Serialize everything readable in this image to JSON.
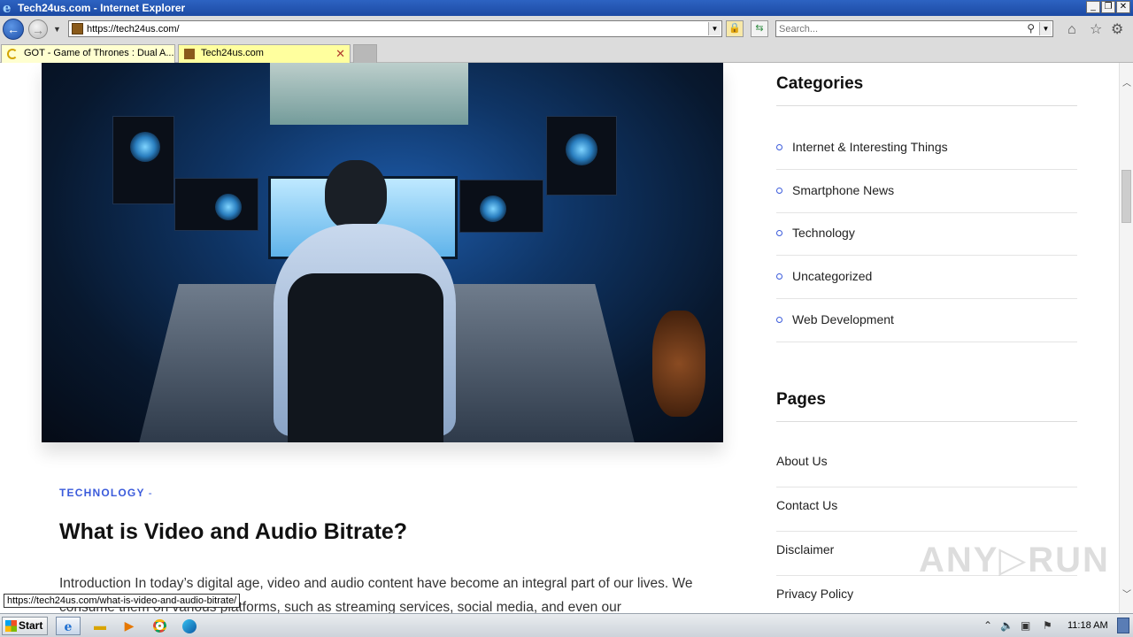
{
  "window": {
    "title": "Tech24us.com - Internet Explorer",
    "controls": [
      "minimize",
      "restore",
      "close"
    ]
  },
  "toolbar": {
    "address_url": "https://tech24us.com/",
    "search_placeholder": "Search..."
  },
  "tabs": [
    {
      "label": "GOT - Game of Thrones : Dual A...",
      "active": false
    },
    {
      "label": "Tech24us.com",
      "active": true
    }
  ],
  "article": {
    "category": "TECHNOLOGY",
    "category_separator": "-",
    "title": "What is Video and Audio Bitrate?",
    "excerpt": "Introduction In today’s digital age, video and audio content have become an integral part of our lives. We consume them on various platforms, such as streaming services, social media, and even our"
  },
  "sidebar": {
    "categories_heading": "Categories",
    "categories": [
      {
        "label": "Internet & Interesting Things"
      },
      {
        "label": "Smartphone News"
      },
      {
        "label": "Technology"
      },
      {
        "label": "Uncategorized"
      },
      {
        "label": "Web Development"
      }
    ],
    "pages_heading": "Pages",
    "pages": [
      {
        "label": "About Us"
      },
      {
        "label": "Contact Us"
      },
      {
        "label": "Disclaimer"
      },
      {
        "label": "Privacy Policy"
      }
    ]
  },
  "status_url": "https://tech24us.com/what-is-video-and-audio-bitrate/",
  "watermark": "ANY▷RUN",
  "taskbar": {
    "start_label": "Start",
    "apps": [
      "internet-explorer",
      "file-explorer",
      "media-player",
      "chrome",
      "edge"
    ],
    "clock": "11:18 AM"
  },
  "colors": {
    "accent": "#3b5bdb",
    "titlebar": "#2d63c2",
    "active_tab": "#ffff9e"
  }
}
